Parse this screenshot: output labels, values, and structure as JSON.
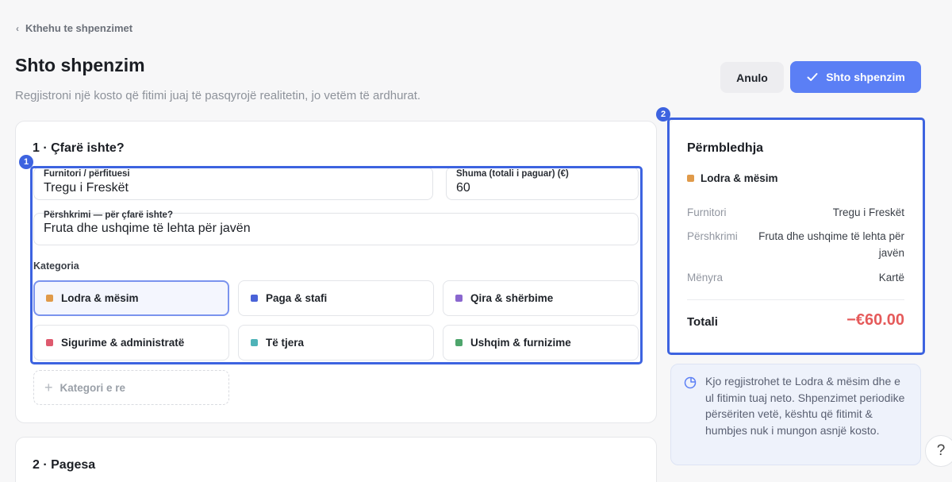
{
  "nav": {
    "back_label": "Kthehu te shpenzimet"
  },
  "header": {
    "title": "Shto shpenzim",
    "subtitle": "Regjistroni një kosto që fitimi juaj të pasqyrojë realitetin, jo vetëm të ardhurat."
  },
  "actions": {
    "cancel_label": "Anulo",
    "submit_label": "Shto shpenzim"
  },
  "section1": {
    "title": "1 · Çfarë ishte?",
    "supplier": {
      "label": "Furnitori / përfituesi",
      "value": "Tregu i Freskët"
    },
    "amount": {
      "label": "Shuma (totali i paguar) (€)",
      "value": "60"
    },
    "description": {
      "label": "Përshkrimi — për çfarë ishte?",
      "value": "Fruta dhe ushqime të lehta për javën"
    },
    "category_label": "Kategoria",
    "categories": [
      {
        "label": "Lodra & mësim",
        "color": "#e09a4a",
        "selected": true
      },
      {
        "label": "Paga & stafi",
        "color": "#4a63d8",
        "selected": false
      },
      {
        "label": "Qira & shërbime",
        "color": "#8a67cf",
        "selected": false
      },
      {
        "label": "Sigurime & administratë",
        "color": "#de5a6e",
        "selected": false
      },
      {
        "label": "Të tjera",
        "color": "#4fb3b8",
        "selected": false
      },
      {
        "label": "Ushqim & furnizime",
        "color": "#4ea56c",
        "selected": false
      }
    ],
    "new_category_label": "Kategori e re"
  },
  "section2": {
    "title": "2 · Pagesa"
  },
  "highlights": {
    "badge_1": "1",
    "badge_2": "2"
  },
  "summary": {
    "title": "Përmbledhja",
    "category": "Lodra & mësim",
    "supplier_key": "Furnitori",
    "supplier_value": "Tregu i Freskët",
    "description_key": "Përshkrimi",
    "description_value": "Fruta dhe ushqime të lehta për javën",
    "method_key": "Mënyra",
    "method_value": "Kartë",
    "total_key": "Totali",
    "total_value": "−€60.00"
  },
  "info": {
    "text": "Kjo regjistrohet te Lodra & mësim dhe e ul fitimin tuaj neto. Shpenzimet periodike përsëriten vetë, kështu që fitimit & humbjes nuk i mungon asnjë kosto."
  },
  "help_label": "?"
}
